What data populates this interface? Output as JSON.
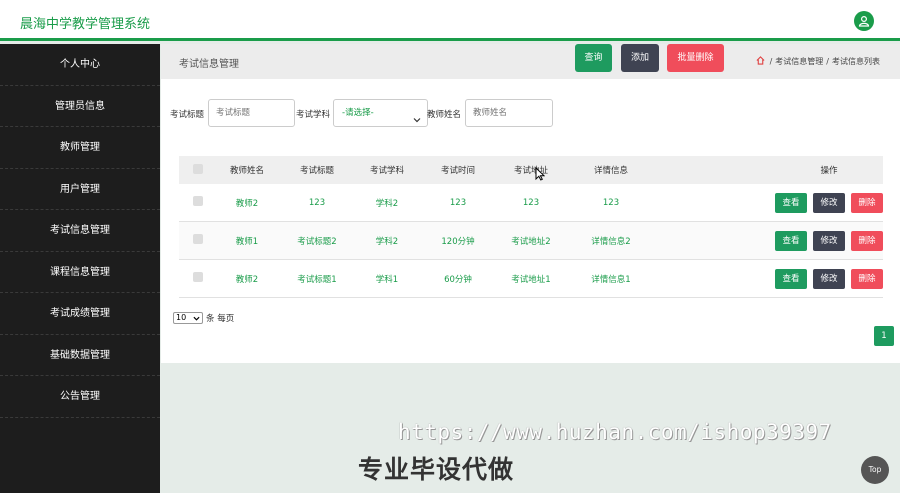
{
  "header": {
    "app_title": "晨海中学教学管理系统",
    "user_icon": "user-icon",
    "accent_color": "#1a9c4a"
  },
  "sidebar": {
    "items": [
      {
        "label": "个人中心"
      },
      {
        "label": "管理员信息"
      },
      {
        "label": "教师管理"
      },
      {
        "label": "用户管理"
      },
      {
        "label": "考试信息管理"
      },
      {
        "label": "课程信息管理"
      },
      {
        "label": "考试成绩管理"
      },
      {
        "label": "基础数据管理"
      },
      {
        "label": "公告管理"
      }
    ]
  },
  "page": {
    "title": "考试信息管理",
    "breadcrumb": {
      "level1": "考试信息管理",
      "sep": "/",
      "level2": "考试信息列表"
    }
  },
  "filters": {
    "title_label": "考试标题",
    "title_placeholder": "考试标题",
    "subject_label": "考试学科",
    "subject_selected": "-请选择-",
    "teacher_label": "教师姓名",
    "teacher_placeholder": "教师姓名",
    "search_button": "查询",
    "add_button": "添加",
    "batch_delete_button": "批量删除"
  },
  "table": {
    "headers": [
      "教师姓名",
      "考试标题",
      "考试学科",
      "考试时间",
      "考试地址",
      "详情信息",
      "操作"
    ],
    "rows": [
      {
        "teacher": "教师2",
        "title": "123",
        "subject": "学科2",
        "time": "123",
        "address": "123",
        "detail": "123"
      },
      {
        "teacher": "教师1",
        "title": "考试标题2",
        "subject": "学科2",
        "time": "120分钟",
        "address": "考试地址2",
        "detail": "详情信息2"
      },
      {
        "teacher": "教师2",
        "title": "考试标题1",
        "subject": "学科1",
        "time": "60分钟",
        "address": "考试地址1",
        "detail": "详情信息1"
      }
    ],
    "actions": {
      "view": "查看",
      "edit": "修改",
      "delete": "删除"
    }
  },
  "pagination": {
    "page_size": "10",
    "per_page_text": "条 每页",
    "current_page": "1"
  },
  "overlay": {
    "watermark": "https://www.huzhan.com/ishop39397",
    "banner": "专业毕设代做",
    "top_button": "Top"
  }
}
